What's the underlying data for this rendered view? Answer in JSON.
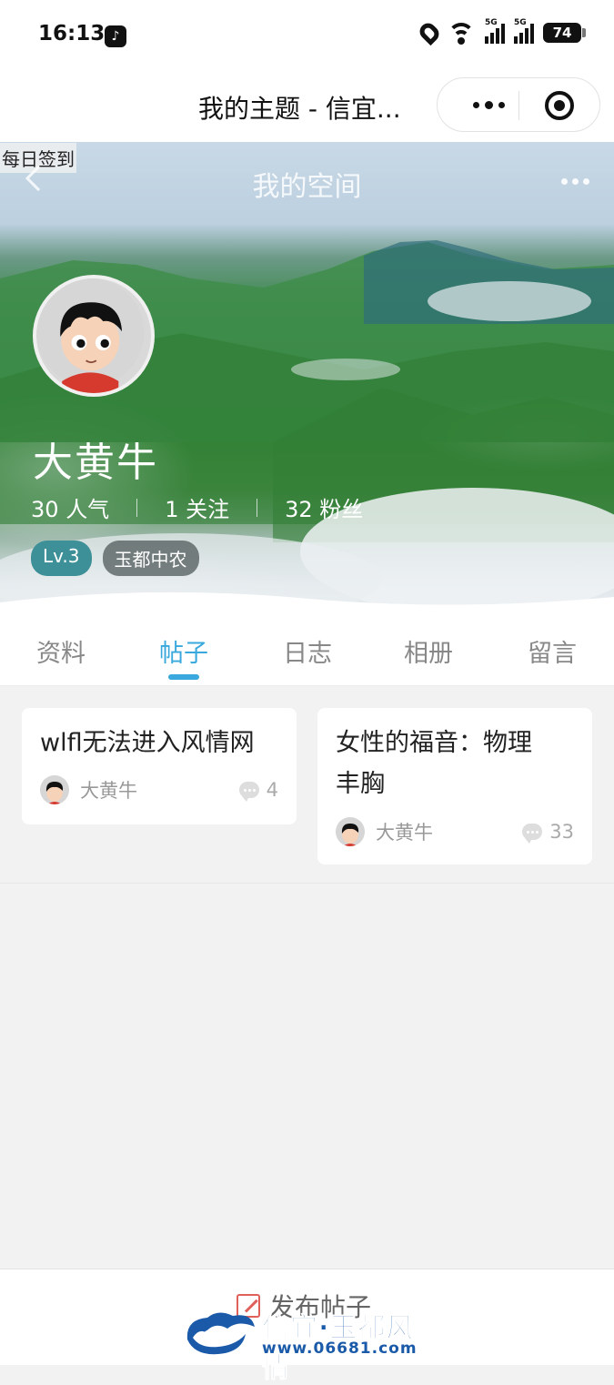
{
  "status_bar": {
    "time": "16:13",
    "network": [
      "5G",
      "5G"
    ],
    "battery": "74"
  },
  "nav": {
    "title": "我的主题 - 信宜..."
  },
  "hero": {
    "checkin_label": "每日签到",
    "space_title": "我的空间",
    "username": "大黄牛",
    "stats": [
      {
        "value": "30",
        "label": "人气"
      },
      {
        "value": "1",
        "label": "关注"
      },
      {
        "value": "32",
        "label": "粉丝"
      }
    ],
    "level": "Lv.3",
    "group": "玉都中农"
  },
  "tabs": [
    "资料",
    "帖子",
    "日志",
    "相册",
    "留言"
  ],
  "active_tab": "帖子",
  "posts": [
    {
      "title_lines": [
        "wlfl无法进入风情网"
      ],
      "author": "大黄牛",
      "comments": "4"
    },
    {
      "title_lines": [
        "女性的福音：物理",
        "丰胸"
      ],
      "author": "大黄牛",
      "comments": "33"
    }
  ],
  "bottom": {
    "publish_label": "发布帖子"
  },
  "watermark": {
    "title": "信宜·玉都风情",
    "url": "www.06681.com"
  },
  "colors": {
    "accent": "#39a8dc",
    "level_badge": "#3d8f98"
  }
}
